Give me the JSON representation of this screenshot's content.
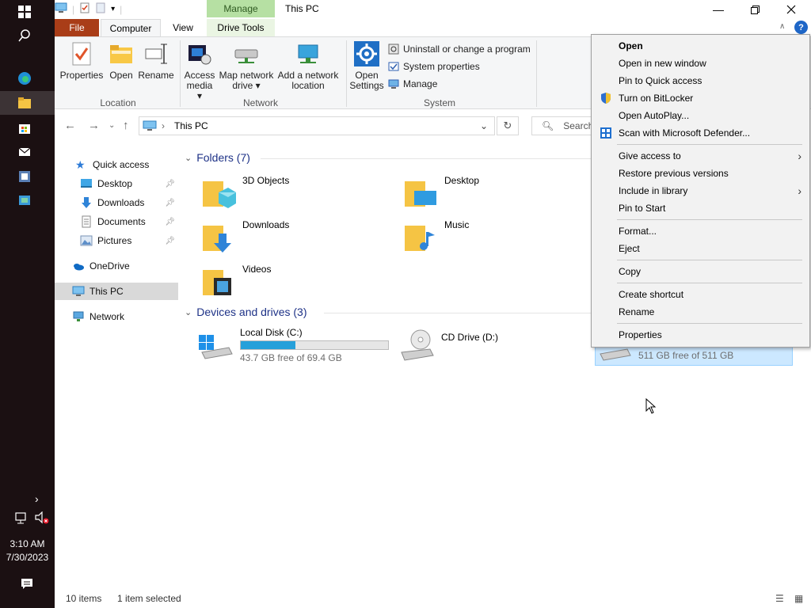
{
  "taskbar": {
    "time": "3:10 AM",
    "date": "7/30/2023"
  },
  "window": {
    "title": "This PC",
    "contextual_tab_group": "Manage"
  },
  "ribbon_tabs": {
    "file": "File",
    "computer": "Computer",
    "view": "View",
    "drive_tools": "Drive Tools"
  },
  "ribbon": {
    "location": {
      "label": "Location",
      "properties": "Properties",
      "open": "Open",
      "rename": "Rename"
    },
    "network": {
      "label": "Network",
      "access_media_1": "Access",
      "access_media_2": "media",
      "map_drive_1": "Map network",
      "map_drive_2": "drive",
      "add_location_1": "Add a network",
      "add_location_2": "location"
    },
    "system": {
      "label": "System",
      "open_settings_1": "Open",
      "open_settings_2": "Settings",
      "uninstall": "Uninstall or change a program",
      "system_properties": "System properties",
      "manage": "Manage"
    }
  },
  "address": {
    "path": "This PC",
    "search_placeholder": "Search"
  },
  "nav_pane": {
    "quick_access": "Quick access",
    "desktop": "Desktop",
    "downloads": "Downloads",
    "documents": "Documents",
    "pictures": "Pictures",
    "onedrive": "OneDrive",
    "this_pc": "This PC",
    "network": "Network"
  },
  "content": {
    "folders_header": "Folders (7)",
    "folders": [
      "3D Objects",
      "Desktop",
      "Downloads",
      "Music",
      "Videos"
    ],
    "drives_header": "Devices and drives (3)",
    "drives": [
      {
        "name": "Local Disk (C:)",
        "free": "43.7 GB free of 69.4 GB",
        "used_fraction": 0.37
      },
      {
        "name": "CD Drive (D:)"
      },
      {
        "free": "511 GB free of 511 GB"
      }
    ]
  },
  "status": {
    "items": "10 items",
    "selected": "1 item selected"
  },
  "context_menu": {
    "open": "Open",
    "open_new_window": "Open in new window",
    "pin_quick": "Pin to Quick access",
    "bitlocker": "Turn on BitLocker",
    "autoplay": "Open AutoPlay...",
    "defender": "Scan with Microsoft Defender...",
    "give_access": "Give access to",
    "restore": "Restore previous versions",
    "include_library": "Include in library",
    "pin_start": "Pin to Start",
    "format": "Format...",
    "eject": "Eject",
    "copy": "Copy",
    "create_shortcut": "Create shortcut",
    "rename": "Rename",
    "properties": "Properties"
  }
}
